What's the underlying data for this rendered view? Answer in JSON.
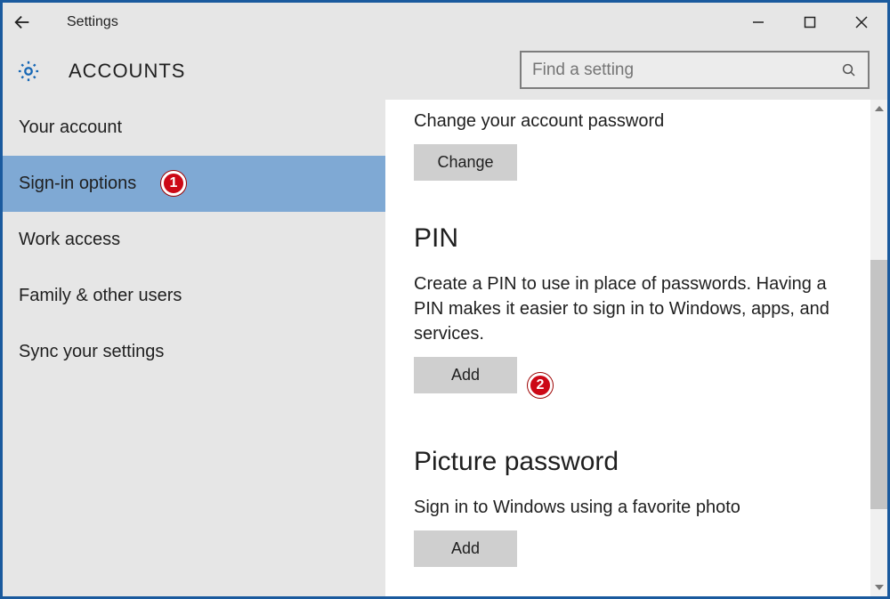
{
  "titlebar": {
    "title": "Settings"
  },
  "header": {
    "section": "ACCOUNTS",
    "search_placeholder": "Find a setting"
  },
  "sidebar": {
    "items": [
      {
        "label": "Your account"
      },
      {
        "label": "Sign-in options"
      },
      {
        "label": "Work access"
      },
      {
        "label": "Family & other users"
      },
      {
        "label": "Sync your settings"
      }
    ],
    "selected_index": 1
  },
  "content": {
    "password": {
      "desc": "Change your account password",
      "button": "Change"
    },
    "pin": {
      "heading": "PIN",
      "desc": "Create a PIN to use in place of passwords. Having a PIN makes it easier to sign in to Windows, apps, and services.",
      "button": "Add"
    },
    "picture": {
      "heading": "Picture password",
      "desc": "Sign in to Windows using a favorite photo",
      "button": "Add"
    }
  },
  "annotations": {
    "badge1": "1",
    "badge2": "2"
  }
}
